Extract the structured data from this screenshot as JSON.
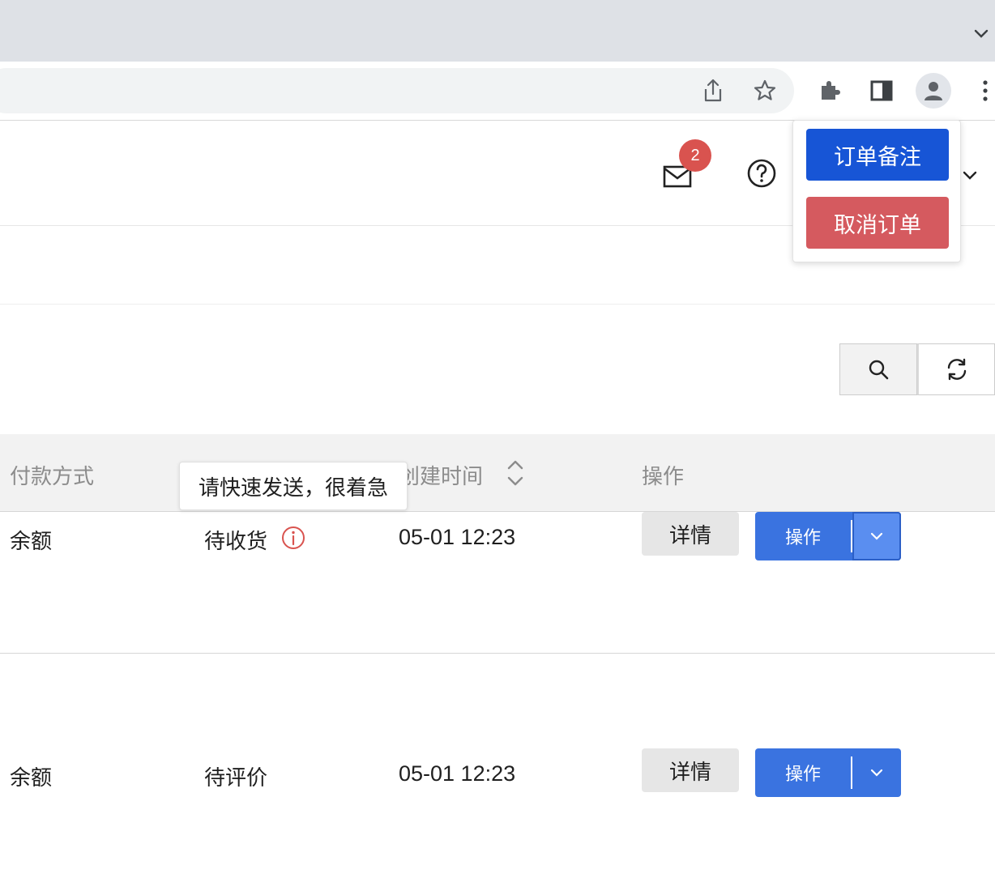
{
  "header": {
    "mail_badge_count": "2"
  },
  "dropdown": {
    "items": [
      {
        "label": "订单备注",
        "color": "#1755d6"
      },
      {
        "label": "取消订单",
        "color": "#d55a5f"
      }
    ]
  },
  "tooltip": {
    "text": "请快速发送，很着急"
  },
  "table": {
    "columns": [
      "付款方式",
      "创建时间",
      "操作"
    ],
    "rows": [
      {
        "payment": "余额",
        "status": "待收货",
        "created": "05-01 12:23",
        "detail_label": "详情",
        "action_label": "操作"
      },
      {
        "payment": "余额",
        "status": "待评价",
        "created": "05-01 12:23",
        "detail_label": "详情",
        "action_label": "操作"
      }
    ]
  },
  "colors": {
    "primary": "#3a73e0",
    "danger": "#d9534f"
  }
}
